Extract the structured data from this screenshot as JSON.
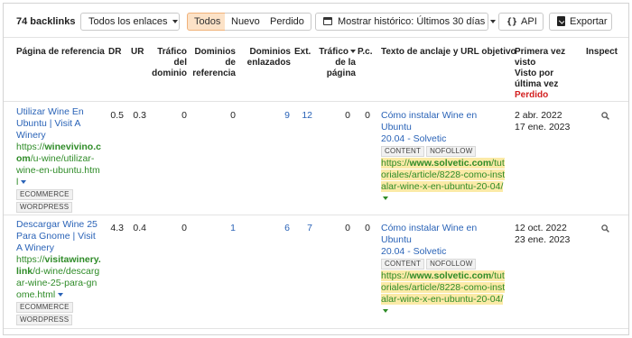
{
  "toolbar": {
    "count": "74 backlinks",
    "filter_label": "Todos los enlaces",
    "segments": [
      "Todos",
      "Nuevo",
      "Perdido"
    ],
    "history_label": "Mostrar histórico: Últimos 30 días",
    "api_icon": "{}",
    "api_label": "API",
    "export_label": "Exportar"
  },
  "columns": {
    "ref_page": "Página de referencia",
    "dr": "DR",
    "ur": "UR",
    "domain_traffic": [
      "Tráfico",
      "del",
      "dominio"
    ],
    "ref_domains": [
      "Dominios",
      "de",
      "referencia"
    ],
    "linked_domains": [
      "Dominios",
      "enlazados"
    ],
    "ext": "Ext.",
    "page_traffic": [
      "Tráfico",
      "de la",
      "página"
    ],
    "pc": "P.c.",
    "anchor": "Texto de anclaje y URL objetivo",
    "first_seen": [
      "Primera vez",
      "visto",
      "Visto por",
      "última vez"
    ],
    "lost": "Perdido",
    "inspect": "Inspect"
  },
  "rows": [
    {
      "title": [
        "Utilizar Wine En",
        "Ubuntu | Visit A",
        "Winery"
      ],
      "url": [
        "https://",
        "winevivino.c",
        "om",
        "/u-wine/utilizar-",
        "wine-en-ubuntu.htm",
        "l"
      ],
      "tags": [
        "ECOMMERCE",
        "WORDPRESS"
      ],
      "dr": "0.5",
      "ur": "0.3",
      "domain_traffic": "0",
      "ref_domains": "0",
      "linked_domains": "9",
      "ext": "12",
      "page_traffic": "0",
      "pc": "0",
      "anchor": [
        "Cómo instalar Wine en Ubuntu",
        "20.04 - Solvetic"
      ],
      "anchor_tags": [
        "CONTENT",
        "NOFOLLOW"
      ],
      "target": [
        "https://",
        "www.solvetic.com",
        "/tut",
        "oriales/article/8228-como-inst",
        "alar-wine-x-en-ubuntu-20-04/"
      ],
      "first_seen": "2 abr. 2022",
      "last_seen": "17 ene. 2023"
    },
    {
      "title": [
        "Descargar Wine 25",
        "Para Gnome | Visit",
        "A Winery"
      ],
      "url": [
        "https://",
        "visitawinery.",
        "link",
        "/d-wine/descarg",
        "ar-wine-25-para-gn",
        "ome.html"
      ],
      "tags": [
        "ECOMMERCE",
        "WORDPRESS"
      ],
      "dr": "4.3",
      "ur": "0.4",
      "domain_traffic": "0",
      "ref_domains": "1",
      "linked_domains": "6",
      "ext": "7",
      "page_traffic": "0",
      "pc": "0",
      "anchor": [
        "Cómo instalar Wine en Ubuntu",
        "20.04 - Solvetic"
      ],
      "anchor_tags": [
        "CONTENT",
        "NOFOLLOW"
      ],
      "target": [
        "https://",
        "www.solvetic.com",
        "/tut",
        "oriales/article/8228-como-inst",
        "alar-wine-x-en-ubuntu-20-04/"
      ],
      "first_seen": "12 oct. 2022",
      "last_seen": "23 ene. 2023"
    }
  ]
}
